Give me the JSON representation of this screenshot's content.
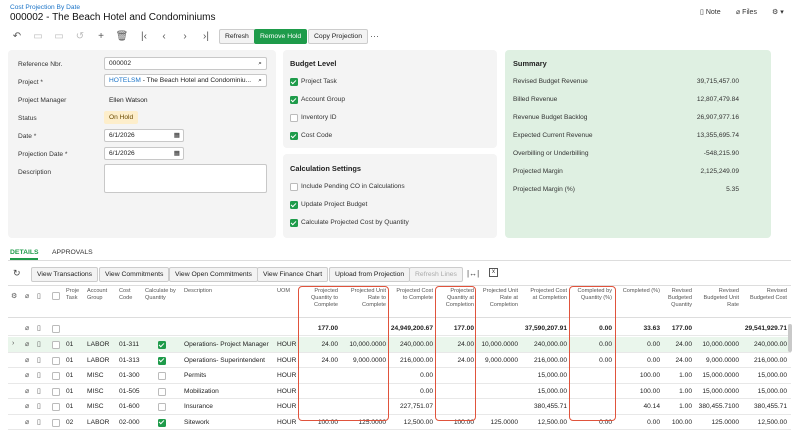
{
  "header": {
    "breadcrumb": "Cost Projection By Date",
    "title": "000002 - The Beach Hotel and Condominiums",
    "note_label": "Note",
    "files_label": "Files"
  },
  "toolbar": {
    "refresh_label": "Refresh",
    "remove_hold_label": "Remove Hold",
    "copy_projection_label": "Copy Projection",
    "more": "···"
  },
  "form": {
    "ref_label": "Reference Nbr.",
    "ref_value": "000002",
    "project_label": "Project *",
    "project_code": "HOTELSM",
    "project_name": " - The Beach Hotel and Condominiu...",
    "manager_label": "Project Manager",
    "manager_value": "Ellen Watson",
    "status_label": "Status",
    "status_value": "On Hold",
    "date_label": "Date *",
    "date_value": "6/1/2026",
    "projdate_label": "Projection Date *",
    "projdate_value": "6/1/2026",
    "desc_label": "Description"
  },
  "budget_level": {
    "title": "Budget Level",
    "items": [
      {
        "label": "Project Task",
        "checked": true
      },
      {
        "label": "Account Group",
        "checked": true
      },
      {
        "label": "Inventory ID",
        "checked": false
      },
      {
        "label": "Cost Code",
        "checked": true
      }
    ]
  },
  "calc_settings": {
    "title": "Calculation Settings",
    "items": [
      {
        "label": "Include Pending CO in Calculations",
        "checked": false
      },
      {
        "label": "Update Project Budget",
        "checked": true
      },
      {
        "label": "Calculate Projected Cost by Quantity",
        "checked": true
      }
    ]
  },
  "summary": {
    "title": "Summary",
    "rows": [
      {
        "label": "Revised Budget Revenue",
        "value": "39,715,457.00"
      },
      {
        "label": "Billed Revenue",
        "value": "12,807,479.84"
      },
      {
        "label": "Revenue Budget Backlog",
        "value": "26,907,977.16"
      },
      {
        "label": "Expected Current Revenue",
        "value": "13,355,695.74"
      },
      {
        "label": "Overbilling or Underbilling",
        "value": "-548,215.90"
      },
      {
        "label": "Projected Margin",
        "value": "2,125,249.09"
      },
      {
        "label": "Projected Margin (%)",
        "value": "5.35"
      }
    ]
  },
  "tabs": {
    "details": "DETAILS",
    "approvals": "APPROVALS"
  },
  "grid_toolbar": {
    "view_transactions": "View Transactions",
    "view_commitments": "View Commitments",
    "view_open_commitments": "View Open Commitments",
    "view_finance_chart": "View Finance Chart",
    "upload_from_projection": "Upload from Projection",
    "refresh_lines": "Refresh Lines"
  },
  "grid": {
    "columns": {
      "task": "Proje\nTask",
      "account_group": "Account\nGroup",
      "cost_code": "Cost\nCode",
      "calc_by_qty": "Calculate by\nQuantity",
      "description": "Description",
      "uom": "UOM",
      "pqtc": "Projected\nQuantity to\nComplete",
      "purtc": "Projected Unit\nRate to\nComplete",
      "pctc": "Projected Cost\nto Complete",
      "pqac": "Projected\nQuantity at\nCompletion",
      "purac": "Projected Unit\nRate at\nCompletion",
      "pcac": "Projected Cost\nat Completion",
      "cbq": "Completed by\nQuantity (%)",
      "cp": "Completed (%)",
      "rbq": "Revised\nBudgeted\nQuantity",
      "rbur": "Revised\nBudgeted Unit\nRate",
      "rbc": "Revised\nBudgeted Cost"
    },
    "totals": {
      "pqtc": "177.00",
      "pctc": "24,949,200.67",
      "pqac": "177.00",
      "pcac": "37,590,207.91",
      "cbq": "0.00",
      "cp": "33.63",
      "rbq": "177.00",
      "rbc": "29,541,929.71"
    },
    "rows": [
      {
        "task": "01",
        "group": "LABOR",
        "code": "01-311",
        "calc": true,
        "desc": "Operations- Project Manager",
        "uom": "HOUR",
        "pqtc": "24.00",
        "purtc": "10,000.0000",
        "pctc": "240,000.00",
        "pqac": "24.00",
        "purac": "10,000.0000",
        "pcac": "240,000.00",
        "cbq": "0.00",
        "cp": "0.00",
        "rbq": "24.00",
        "rbur": "10,000.0000",
        "rbc": "240,000.00"
      },
      {
        "task": "01",
        "group": "LABOR",
        "code": "01-313",
        "calc": true,
        "desc": "Operations- Superintendent",
        "uom": "HOUR",
        "pqtc": "24.00",
        "purtc": "9,000.0000",
        "pctc": "216,000.00",
        "pqac": "24.00",
        "purac": "9,000.0000",
        "pcac": "216,000.00",
        "cbq": "0.00",
        "cp": "0.00",
        "rbq": "24.00",
        "rbur": "9,000.0000",
        "rbc": "216,000.00"
      },
      {
        "task": "01",
        "group": "MISC",
        "code": "01-300",
        "calc": false,
        "desc": "Permits",
        "uom": "HOUR",
        "pqtc": "",
        "purtc": "",
        "pctc": "0.00",
        "pqac": "",
        "purac": "",
        "pcac": "15,000.00",
        "cbq": "",
        "cp": "100.00",
        "rbq": "1.00",
        "rbur": "15,000.0000",
        "rbc": "15,000.00"
      },
      {
        "task": "01",
        "group": "MISC",
        "code": "01-505",
        "calc": false,
        "desc": "Mobilization",
        "uom": "HOUR",
        "pqtc": "",
        "purtc": "",
        "pctc": "0.00",
        "pqac": "",
        "purac": "",
        "pcac": "15,000.00",
        "cbq": "",
        "cp": "100.00",
        "rbq": "1.00",
        "rbur": "15,000.0000",
        "rbc": "15,000.00"
      },
      {
        "task": "01",
        "group": "MISC",
        "code": "01-600",
        "calc": false,
        "desc": "Insurance",
        "uom": "HOUR",
        "pqtc": "",
        "purtc": "",
        "pctc": "227,751.07",
        "pqac": "",
        "purac": "",
        "pcac": "380,455.71",
        "cbq": "",
        "cp": "40.14",
        "rbq": "1.00",
        "rbur": "380,455.7100",
        "rbc": "380,455.71"
      },
      {
        "task": "02",
        "group": "LABOR",
        "code": "02-000",
        "calc": true,
        "desc": "Sitework",
        "uom": "HOUR",
        "pqtc": "100.00",
        "purtc": "125.0000",
        "pctc": "12,500.00",
        "pqac": "100.00",
        "purac": "125.0000",
        "pcac": "12,500.00",
        "cbq": "0.00",
        "cp": "0.00",
        "rbq": "100.00",
        "rbur": "125.0000",
        "rbc": "12,500.00"
      }
    ]
  },
  "colors": {
    "accent": "#1e9b4a",
    "link": "#1a73c7",
    "highlight": "#e0533c",
    "summary_bg": "#dff0e2"
  }
}
